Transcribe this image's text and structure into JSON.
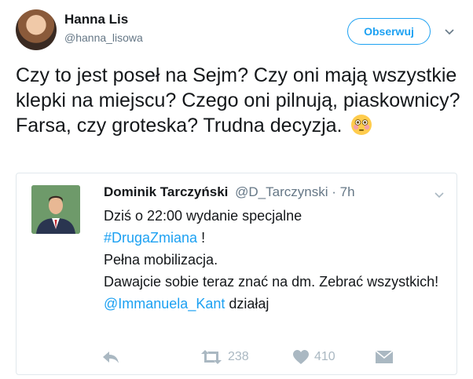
{
  "author": {
    "name": "Hanna Lis",
    "handle": "@hanna_lisowa",
    "follow_label": "Obserwuj"
  },
  "tweet": {
    "text": "Czy to jest poseł na Sejm? Czy oni mają wszystkie klepki na miejscu? Czego oni pilnują, piaskownicy? Farsa, czy groteska? Trudna decyzja.",
    "emoji": "flushed-face-emoji"
  },
  "quoted": {
    "name": "Dominik Tarczyński",
    "handle": "@D_Tarczynski",
    "separator": "·",
    "time": "7h",
    "line1": "Dziś o 22:00 wydanie specjalne",
    "hashtag": "#DrugaZmiana",
    "after_hashtag": " !",
    "line3": "Pełna mobilizacja.",
    "line4": "Dawajcie sobie teraz znać na dm. Zebrać wszystkich!",
    "mention": "@Immanuela_Kant",
    "after_mention": " działaj"
  },
  "actions": {
    "reply_icon": "reply-icon",
    "retweet_icon": "retweet-icon",
    "retweet_count": "238",
    "like_icon": "heart-icon",
    "like_count": "410",
    "dm_icon": "envelope-icon"
  },
  "colors": {
    "accent": "#1da1f2",
    "muted": "#657786",
    "icon": "#aab8c2",
    "border": "#e1e8ed"
  }
}
